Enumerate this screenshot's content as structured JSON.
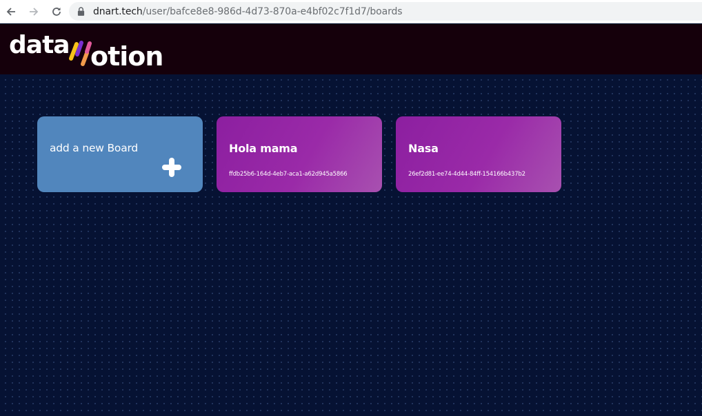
{
  "browser": {
    "url_domain": "dnart.tech",
    "url_path": "/user/bafce8e8-986d-4d73-870a-e4bf02c7f1d7/boards"
  },
  "header": {
    "logo_text_left": "data",
    "logo_text_right": "otion",
    "logo_colors": [
      "#f7c21a",
      "#7b2fd0",
      "#f29a4b",
      "#e25a9c"
    ]
  },
  "boards": {
    "new_board_label": "add a new Board",
    "items": [
      {
        "title": "Hola mama",
        "id": "ffdb25b6-164d-4eb7-aca1-a62d945a5866"
      },
      {
        "title": "Nasa",
        "id": "26ef2d81-ee74-4d44-84ff-154166b437b2"
      }
    ]
  },
  "icons": {
    "back": "arrow-left-icon",
    "forward": "arrow-right-icon",
    "reload": "reload-icon",
    "lock": "lock-icon",
    "add": "plus-icon"
  }
}
